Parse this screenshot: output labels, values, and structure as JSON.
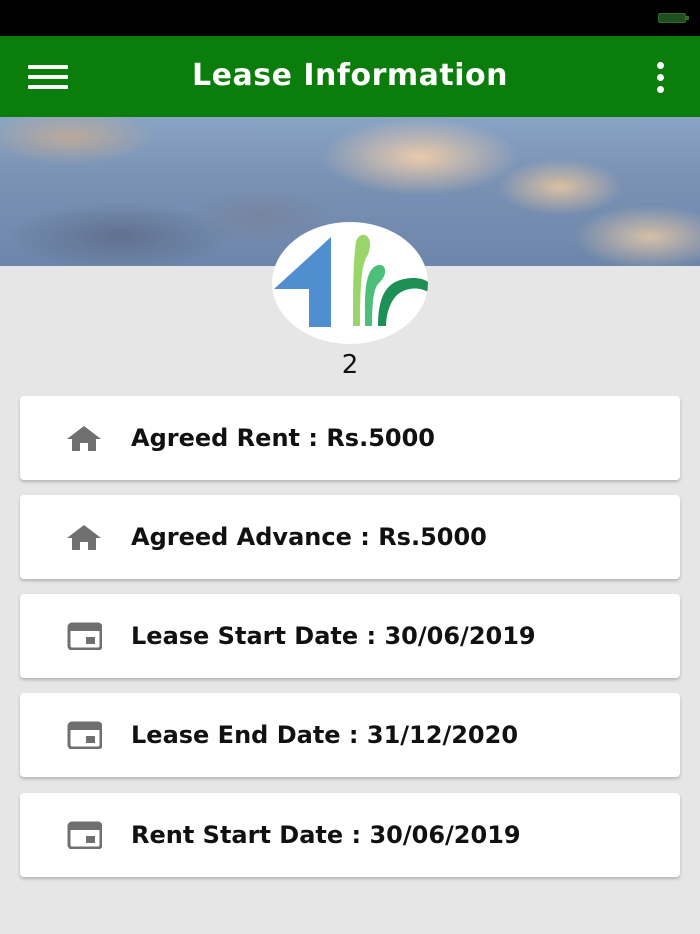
{
  "app_bar": {
    "title": "Lease Information",
    "color": "#0a7d0a"
  },
  "profile": {
    "number": "2"
  },
  "items": [
    {
      "icon": "home-icon",
      "label": "Agreed Rent",
      "value": "Rs.5000"
    },
    {
      "icon": "home-icon",
      "label": "Agreed Advance",
      "value": "Rs.5000"
    },
    {
      "icon": "calendar-icon",
      "label": "Lease Start Date",
      "value": "30/06/2019"
    },
    {
      "icon": "calendar-icon",
      "label": "Lease End Date",
      "value": "31/12/2020"
    },
    {
      "icon": "calendar-icon",
      "label": "Rent Start Date",
      "value": "30/06/2019"
    }
  ],
  "separator": " : "
}
